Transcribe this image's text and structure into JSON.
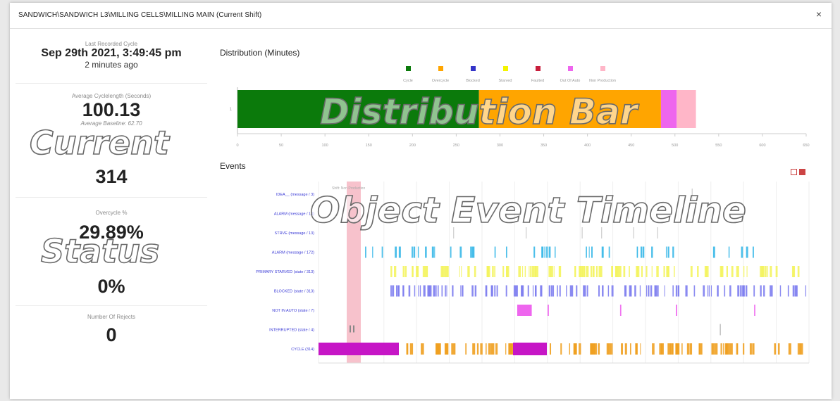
{
  "dialog": {
    "title": "SANDWICH\\SANDWICH L3\\MILLING CELLS\\MILLING MAIN (Current Shift)",
    "close_glyph": "×"
  },
  "stats": {
    "last_cycle_label": "Last Recorded Cycle",
    "last_cycle_value": "Sep 29th 2021, 3:49:45 pm",
    "last_cycle_ago": "2 minutes ago",
    "avg_cycle_label": "Average Cyclelength (Seconds)",
    "avg_cycle_value": "100.13",
    "avg_baseline": "Average Baseline: 62.70",
    "cycles_value": "314",
    "overcycle_label": "Overcycle %",
    "overcycle_value": "29.89%",
    "zero_value": "0%",
    "rejects_label": "Number Of Rejects",
    "rejects_value": "0"
  },
  "overlays": {
    "current": "Current",
    "status": "Status",
    "distribution": "Distribution Bar",
    "timeline": "Object Event Timeline"
  },
  "distribution": {
    "title": "Distribution (Minutes)",
    "legend": [
      {
        "name": "Cycle",
        "color": "#0b7a0b"
      },
      {
        "name": "Overcycle",
        "color": "#ffa500"
      },
      {
        "name": "Blocked",
        "color": "#3434c8"
      },
      {
        "name": "Starved",
        "color": "#f4f400"
      },
      {
        "name": "Faulted",
        "color": "#c81e3c"
      },
      {
        "name": "Out Of Auto",
        "color": "#ee66ee"
      },
      {
        "name": "Non Production",
        "color": "#ffb6c8"
      }
    ],
    "y_tick": "1",
    "x_ticks": [
      "0",
      "50",
      "100",
      "150",
      "200",
      "250",
      "300",
      "350",
      "400",
      "450",
      "500",
      "550",
      "600",
      "650"
    ],
    "xlim": [
      0,
      650
    ],
    "segments": [
      {
        "category": "Cycle",
        "value": 276,
        "color": "#0b7a0b"
      },
      {
        "category": "Overcycle",
        "value": 208,
        "color": "#ffa500"
      },
      {
        "category": "Out Of Auto",
        "value": 18,
        "color": "#ee66ee"
      },
      {
        "category": "Non Production",
        "value": 22,
        "color": "#ffb6c8"
      }
    ]
  },
  "events": {
    "title": "Events",
    "rows": [
      {
        "label": "IDEA__ (message / 3)",
        "color": "#bbbbbb"
      },
      {
        "label": "ALARM (message / 14)",
        "color": "#bbbbbb"
      },
      {
        "label": "STRVE (message / 13)",
        "color": "#bbbbbb"
      },
      {
        "label": "ALARM (message / 172)",
        "color": "#38b8e8"
      },
      {
        "label": "PRIMARY STARVED (state / 313)",
        "color": "#f4f460"
      },
      {
        "label": "BLOCKED (state / 313)",
        "color": "#7e7ef0"
      },
      {
        "label": "NOT IN AUTO (state / 7)",
        "color": "#ee66ee"
      },
      {
        "label": "INTERRUPTED (state / 4)",
        "color": "#999999"
      },
      {
        "label": "CYCLE (314)",
        "color": "#f0a020"
      }
    ],
    "non_production_label": "Shift: Non Production"
  }
}
